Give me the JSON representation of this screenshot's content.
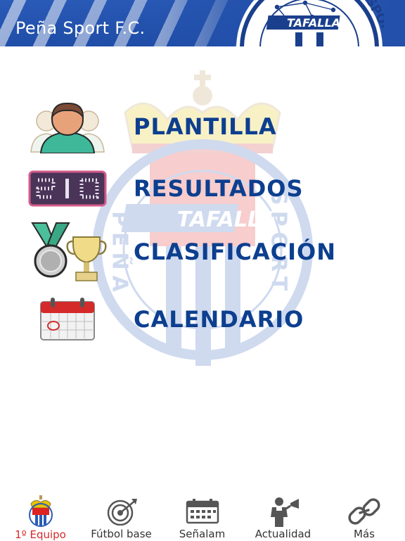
{
  "header": {
    "title": "Peña Sport F.C."
  },
  "crest": {
    "left": "PEÑA",
    "right": "SPORT",
    "center": "TAFALLA"
  },
  "menu": [
    {
      "label": "PLANTILLA",
      "icon": "players-icon"
    },
    {
      "label": "RESULTADOS",
      "icon": "scoreboard-icon"
    },
    {
      "label": "CLASIFICACIÓN",
      "icon": "medal-trophy-icon"
    },
    {
      "label": "CALENDARIO",
      "icon": "calendar-icon"
    }
  ],
  "tabs": [
    {
      "label": "1º Equipo",
      "icon": "club-crest-icon",
      "active": true
    },
    {
      "label": "Fútbol base",
      "icon": "target-icon",
      "active": false
    },
    {
      "label": "Señalam",
      "icon": "calendar-icon",
      "active": false
    },
    {
      "label": "Actualidad",
      "icon": "referee-whistle-icon",
      "active": false
    },
    {
      "label": "Más",
      "icon": "chain-link-icon",
      "active": false
    }
  ],
  "colors": {
    "header_blue": "#2256b0",
    "menu_text": "#0d3f8f",
    "active_tab": "#d42a2a"
  }
}
